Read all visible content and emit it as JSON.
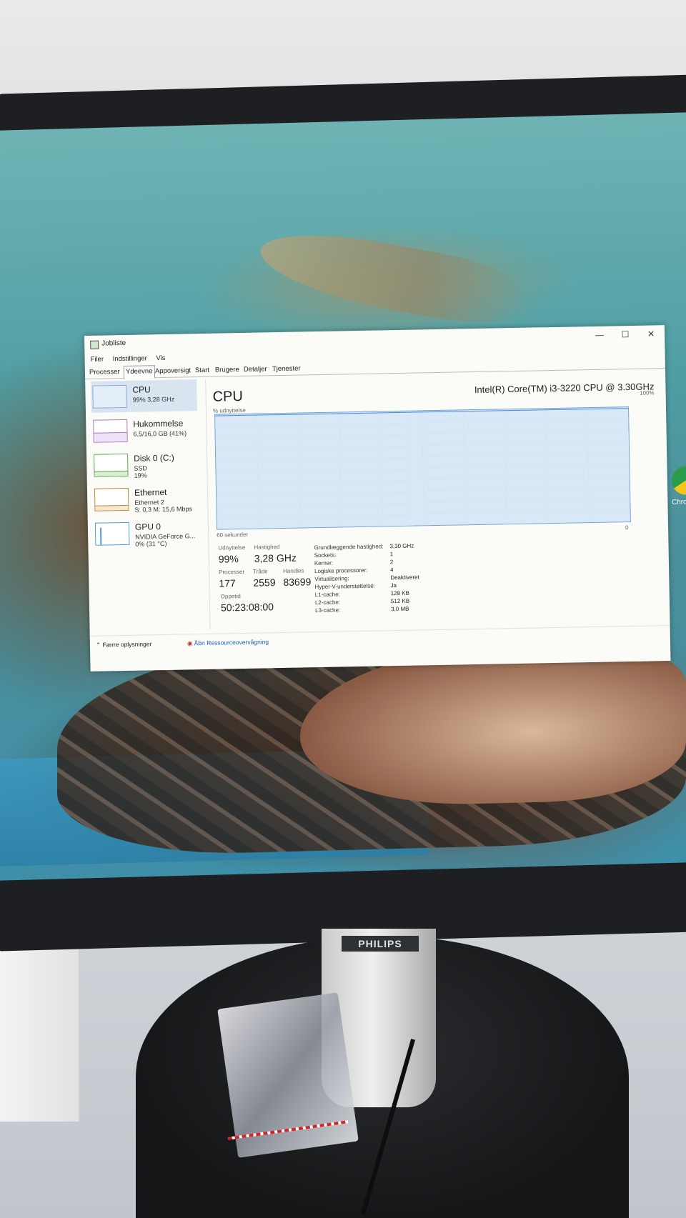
{
  "window": {
    "title": "Jobliste",
    "controls": {
      "minimize": "—",
      "maximize": "☐",
      "close": "✕"
    }
  },
  "menu": [
    "Filer",
    "Indstillinger",
    "Vis"
  ],
  "tabs": [
    "Processer",
    "Ydeevne",
    "Appoversigt",
    "Start",
    "Brugere",
    "Detaljer",
    "Tjenester"
  ],
  "active_tab": "Ydeevne",
  "sidebar": [
    {
      "name": "CPU",
      "line1": "99% 3,28 GHz",
      "line2": "",
      "line3": ""
    },
    {
      "name": "Hukommelse",
      "line1": "6,5/16,0 GB (41%)",
      "line2": "",
      "line3": ""
    },
    {
      "name": "Disk 0 (C:)",
      "line1": "SSD",
      "line2": "19%",
      "line3": ""
    },
    {
      "name": "Ethernet",
      "line1": "Ethernet 2",
      "line2": "S: 0,3 M: 15,6 Mbps",
      "line3": ""
    },
    {
      "name": "GPU 0",
      "line1": "NVIDIA GeForce G...",
      "line2": "0% (31 °C)",
      "line3": ""
    }
  ],
  "main": {
    "heading": "CPU",
    "model": "Intel(R) Core(TM) i3-3220 CPU @ 3.30GHz",
    "util_axis_label": "% udnyttelse",
    "max_label": "100%",
    "time_label": "60 sekunder",
    "min_label": "0",
    "utilization_level": 0.99,
    "stats": {
      "udnyttelse_label": "Udnyttelse",
      "udnyttelse": "99%",
      "hastighed_label": "Hastighed",
      "hastighed": "3,28 GHz",
      "processer_label": "Processer",
      "processer": "177",
      "traade_label": "Tråde",
      "traade": "2559",
      "handles_label": "Handles",
      "handles": "83699",
      "oppetid_label": "Oppetid",
      "oppetid": "50:23:08:00"
    },
    "specs": [
      {
        "label": "Grundlæggende hastighed:",
        "value": "3,30 GHz"
      },
      {
        "label": "Sockets:",
        "value": "1"
      },
      {
        "label": "Kerner:",
        "value": "2"
      },
      {
        "label": "Logiske processorer:",
        "value": "4"
      },
      {
        "label": "Virtualisering:",
        "value": "Deaktiveret"
      },
      {
        "label": "Hyper-V-understøttelse:",
        "value": "Ja"
      },
      {
        "label": "L1-cache:",
        "value": "128 KB"
      },
      {
        "label": "L2-cache:",
        "value": "512 KB"
      },
      {
        "label": "L3-cache:",
        "value": "3,0 MB"
      }
    ]
  },
  "footer": {
    "fewer": "Færre oplysninger",
    "open_monitor": "Åbn Ressourceovervågning"
  },
  "desktop": {
    "chrome_label": "Chro"
  },
  "monitor": {
    "brand": "PHILIPS"
  }
}
